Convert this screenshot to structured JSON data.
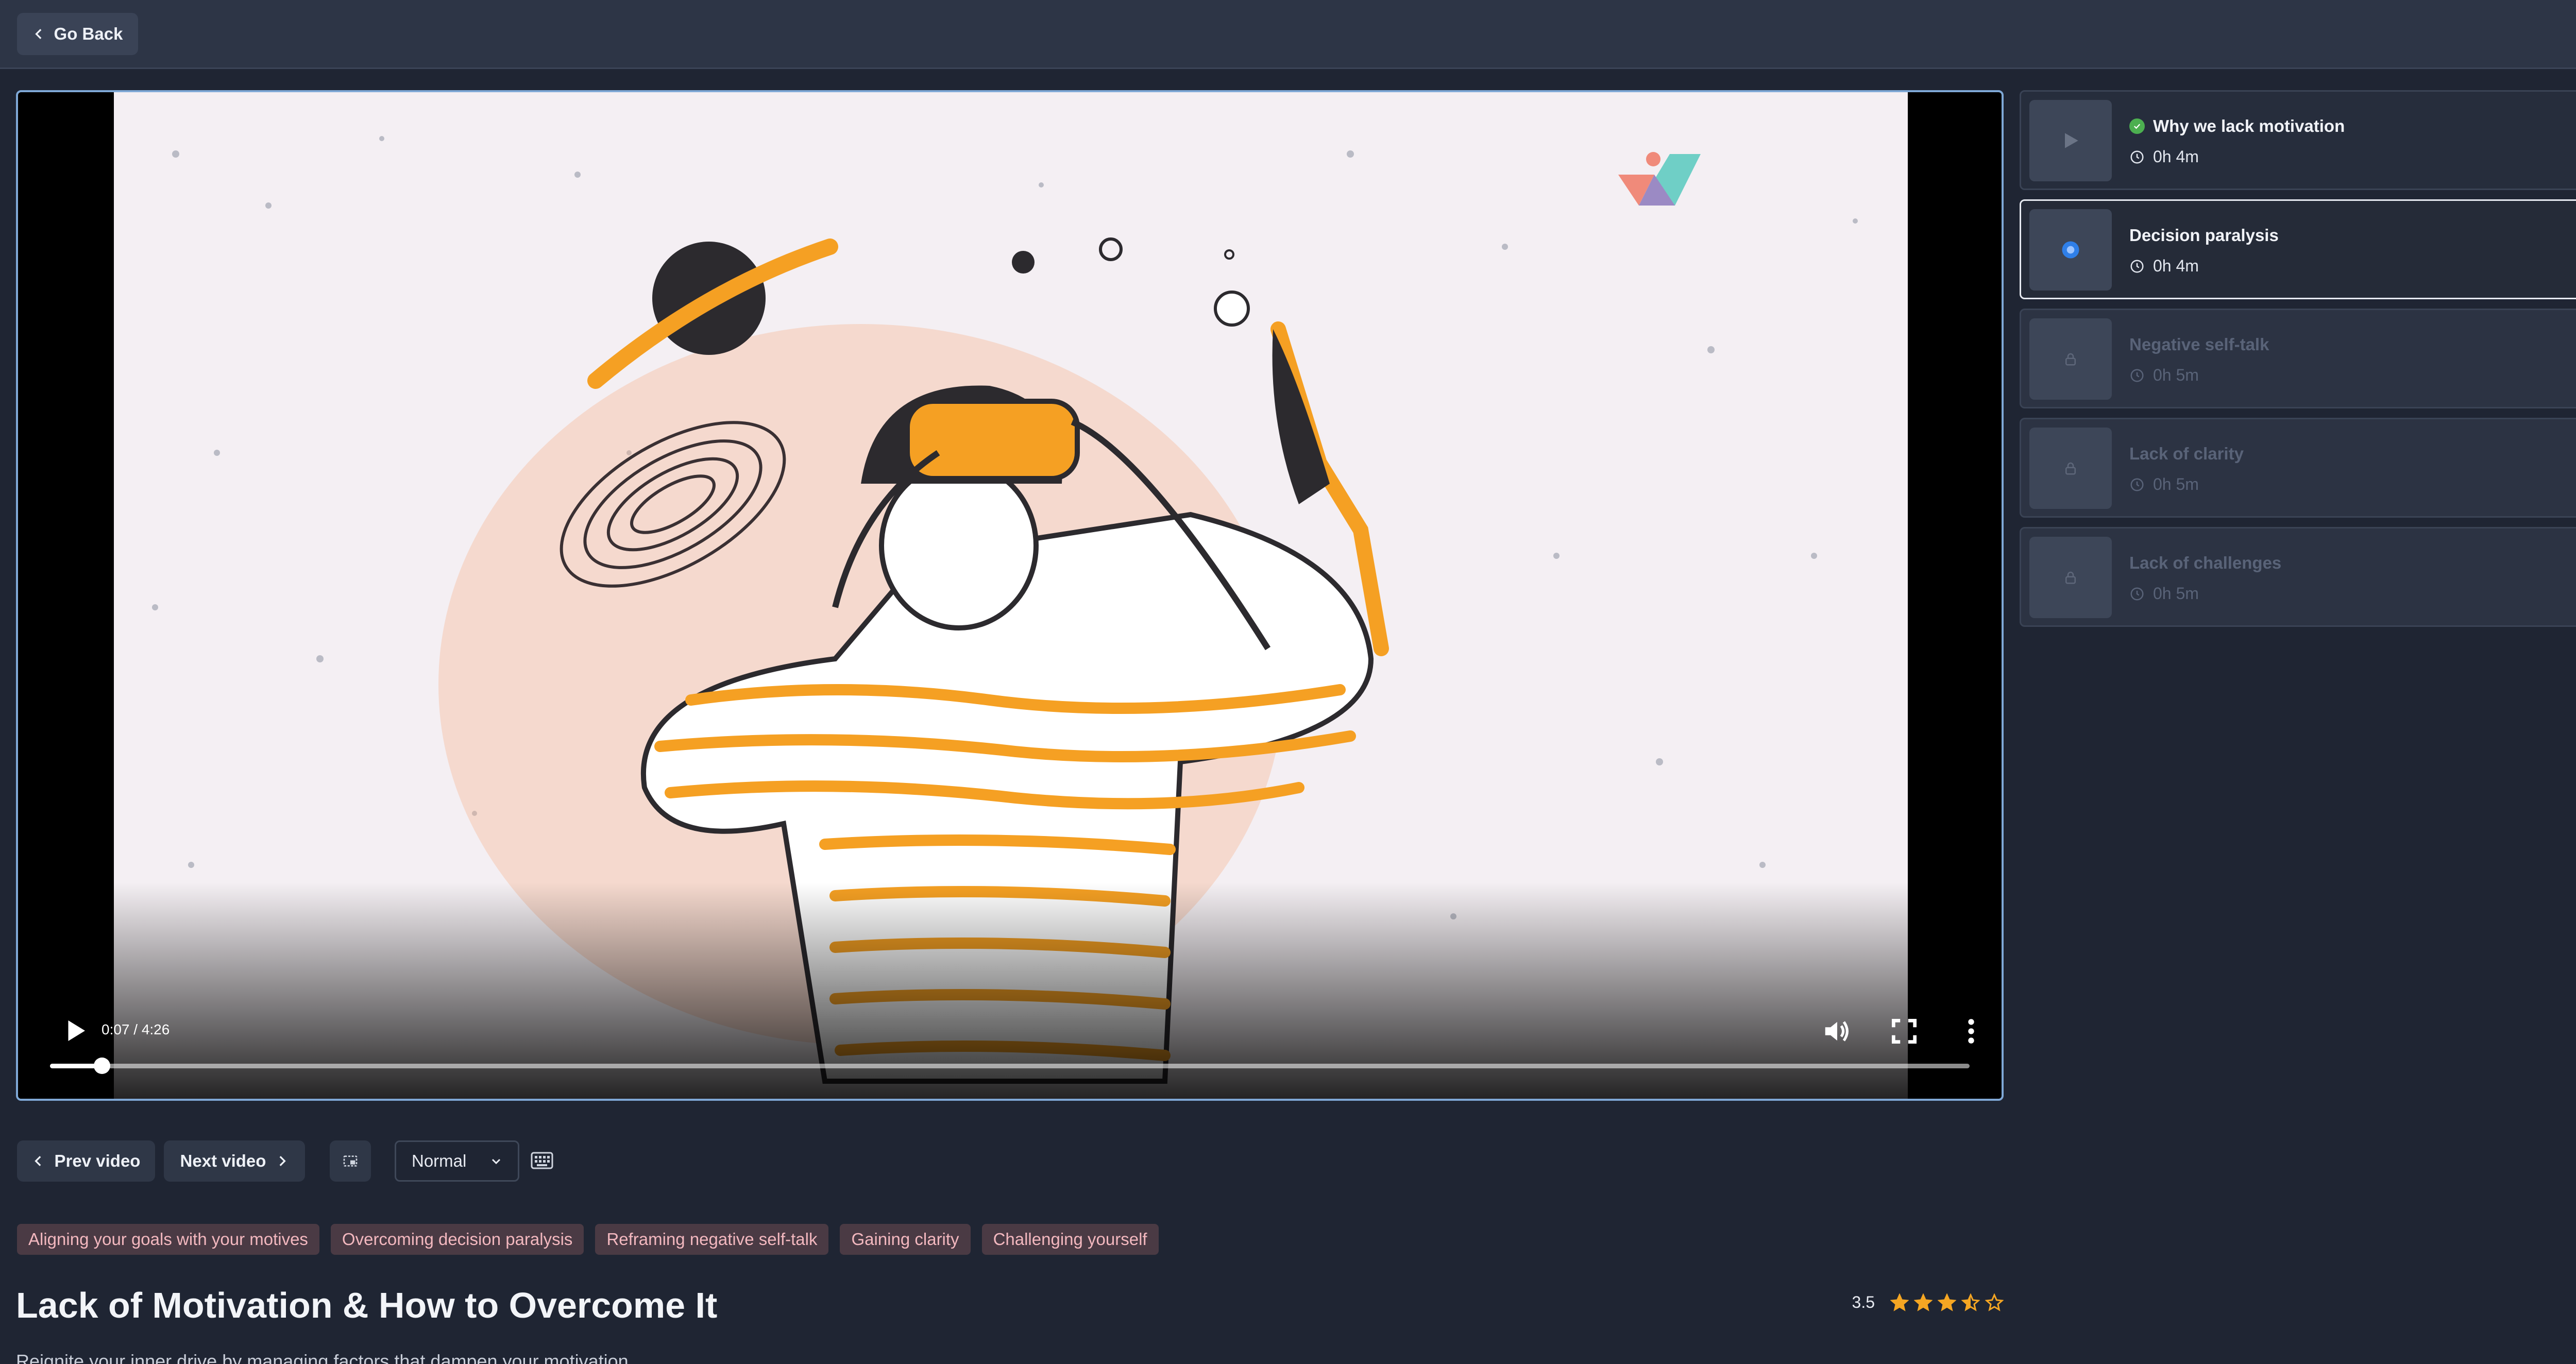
{
  "header": {
    "back_label": "Go Back"
  },
  "player": {
    "time": "0:07 / 4:26",
    "progress": 0.027
  },
  "playlist": [
    {
      "title": "Why we lack motivation",
      "duration": "0h 4m",
      "state": "completed"
    },
    {
      "title": "Decision paralysis",
      "duration": "0h 4m",
      "state": "playing"
    },
    {
      "title": "Negative self-talk",
      "duration": "0h 5m",
      "state": "locked"
    },
    {
      "title": "Lack of clarity",
      "duration": "0h 5m",
      "state": "locked"
    },
    {
      "title": "Lack of challenges",
      "duration": "0h 5m",
      "state": "locked"
    }
  ],
  "controls": {
    "prev_label": "Prev video",
    "next_label": "Next video",
    "speed": "Normal"
  },
  "tags": [
    "Aligning your goals with your motives",
    "Overcoming decision paralysis",
    "Reframing negative self-talk",
    "Gaining clarity",
    "Challenging yourself"
  ],
  "course": {
    "title": "Lack of Motivation & How to Overcome It",
    "rating": "3.5",
    "rating_value": 3.5,
    "rating_max": 5,
    "subtitle": "Reignite your inner drive by managing factors that dampen your motivation."
  },
  "colors": {
    "accent_orange": "#f5a023",
    "star": "#f5a623",
    "tag_bg": "#4a3a44",
    "tag_text": "#f3b8bf",
    "active_dot": "#2f7fe8",
    "check": "#4caf50"
  }
}
